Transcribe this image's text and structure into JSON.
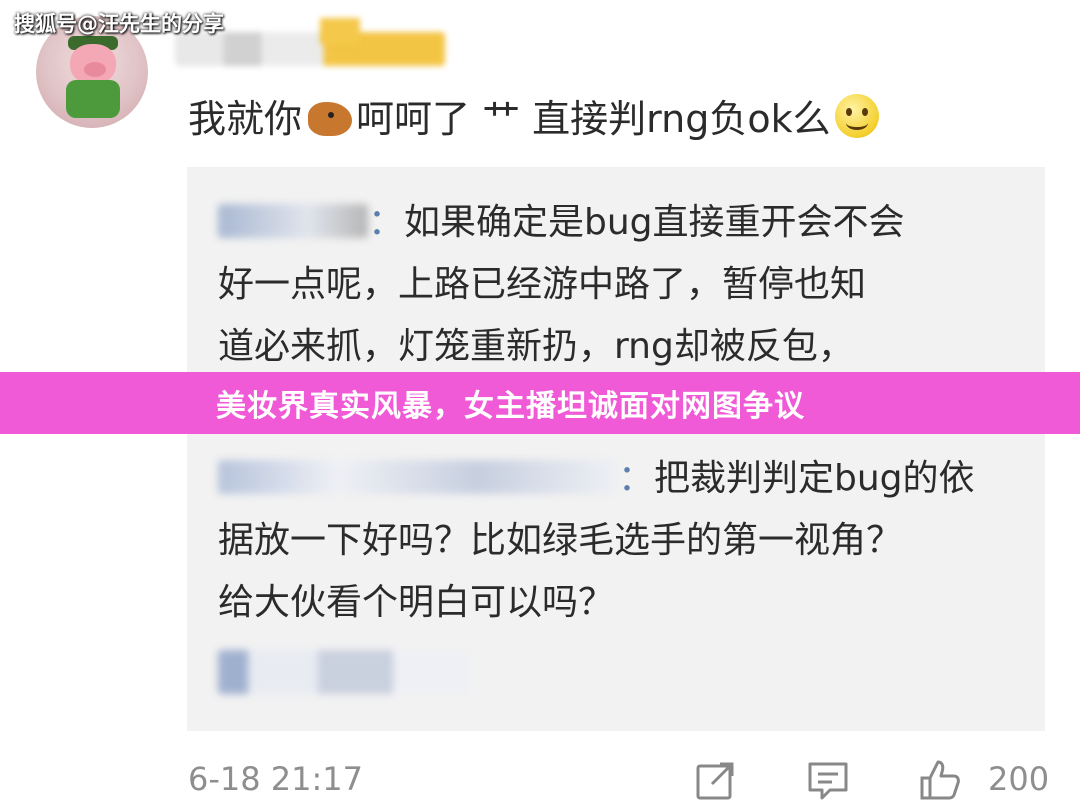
{
  "watermark": "搜狐号@汪先生的分享",
  "comment": {
    "text_before_emoji": "我就你",
    "text_after_emoji": "呵呵了 艹 直接判rng负ok么"
  },
  "replies": [
    {
      "author_suffix": "：",
      "lines": [
        "如果确定是bug直接重开会不会",
        "好一点呢，上路已经游中路了，暂停也知",
        "道必来抓，灯笼重新扔，rng却被反包，"
      ]
    },
    {
      "author_suffix": "：",
      "lines": [
        "把裁判判定bug的依",
        "据放一下好吗？比如绿毛选手的第一视角？",
        "给大伙看个明白可以吗？"
      ]
    }
  ],
  "banner": "美妆界真实风暴，女主播坦诚面对网图争议",
  "footer": {
    "timestamp": "6-18 21:17",
    "like_count": "200"
  },
  "icons": [
    "avatar-icon",
    "horse-emoji-icon",
    "smile-emoji-icon",
    "share-icon",
    "comment-icon",
    "thumbs-up-icon"
  ]
}
